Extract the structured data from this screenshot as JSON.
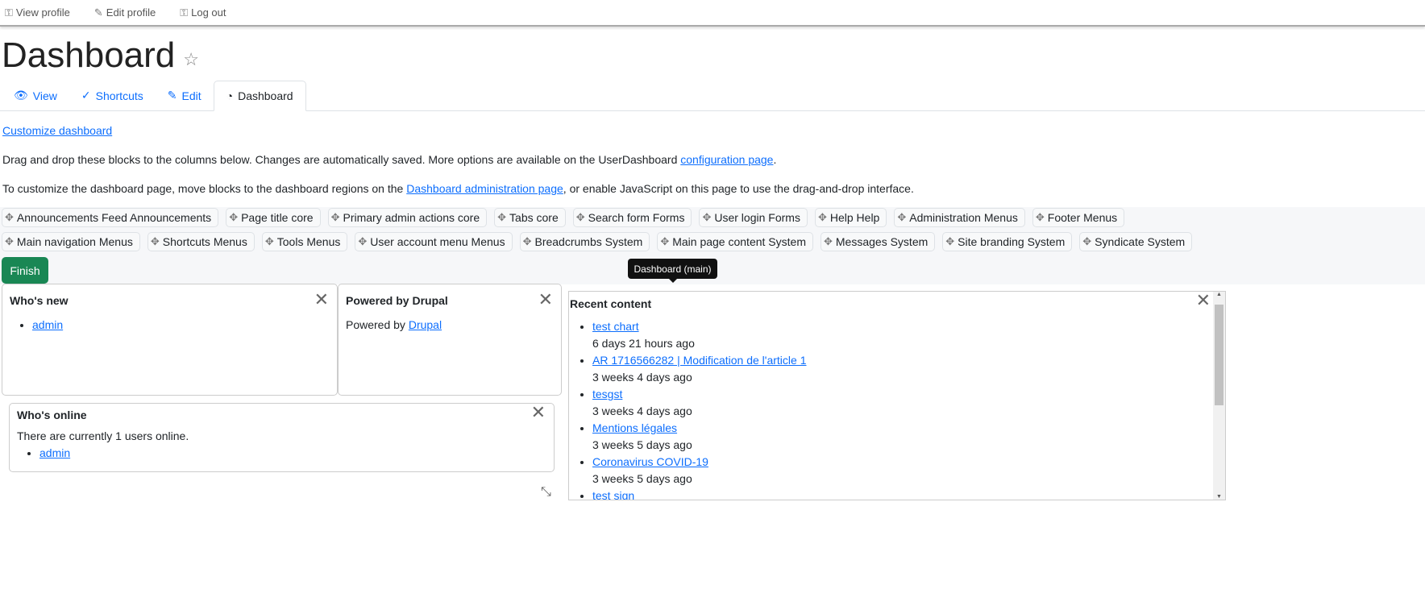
{
  "topbar": {
    "view_profile": "View profile",
    "edit_profile": "Edit profile",
    "log_out": "Log out"
  },
  "page_title": "Dashboard",
  "tabs": [
    {
      "label": "View"
    },
    {
      "label": "Shortcuts"
    },
    {
      "label": "Edit"
    },
    {
      "label": "Dashboard",
      "active": true
    }
  ],
  "customize_link": "Customize dashboard",
  "intro": {
    "text": "Drag and drop these blocks to the columns below. Changes are automatically saved. More options are available on the UserDashboard ",
    "link": "configuration page",
    "end": "."
  },
  "intro2": {
    "text": "To customize the dashboard page, move blocks to the dashboard regions on the ",
    "link": "Dashboard administration page",
    "end": ", or enable JavaScript on this page to use the drag-and-drop interface."
  },
  "blocks_row1": [
    "Announcements Feed Announcements",
    "Page title core",
    "Primary admin actions core",
    "Tabs core",
    "Search form Forms",
    "User login Forms",
    "Help Help",
    "Administration Menus",
    "Footer Menus"
  ],
  "blocks_row2": [
    "Main navigation Menus",
    "Shortcuts Menus",
    "Tools Menus",
    "User account menu Menus",
    "Breadcrumbs System",
    "Main page content System",
    "Messages System",
    "Site branding System",
    "Syndicate System"
  ],
  "finish_label": "Finish",
  "tooltip": "Dashboard (main)",
  "whos_new": {
    "title": "Who's new",
    "items": [
      "admin"
    ]
  },
  "powered": {
    "title": "Powered by Drupal",
    "text": "Powered by ",
    "link": "Drupal"
  },
  "whos_online": {
    "title": "Who's online",
    "text": "There are currently 1 users online.",
    "items": [
      "admin"
    ]
  },
  "recent": {
    "title": "Recent content",
    "items": [
      {
        "title": "test chart",
        "time": "6 days 21 hours ago"
      },
      {
        "title": "AR 1716566282 | Modification de l'article 1",
        "time": "3 weeks 4 days ago"
      },
      {
        "title": "tesgst",
        "time": "3 weeks 4 days ago"
      },
      {
        "title": "Mentions légales",
        "time": "3 weeks 5 days ago"
      },
      {
        "title": "Coronavirus COVID-19",
        "time": "3 weeks 5 days ago"
      },
      {
        "title": "test sign",
        "time": ""
      }
    ]
  },
  "colors": {
    "link": "#0d6efd",
    "finish": "#198754",
    "tooltip": "#111111"
  }
}
